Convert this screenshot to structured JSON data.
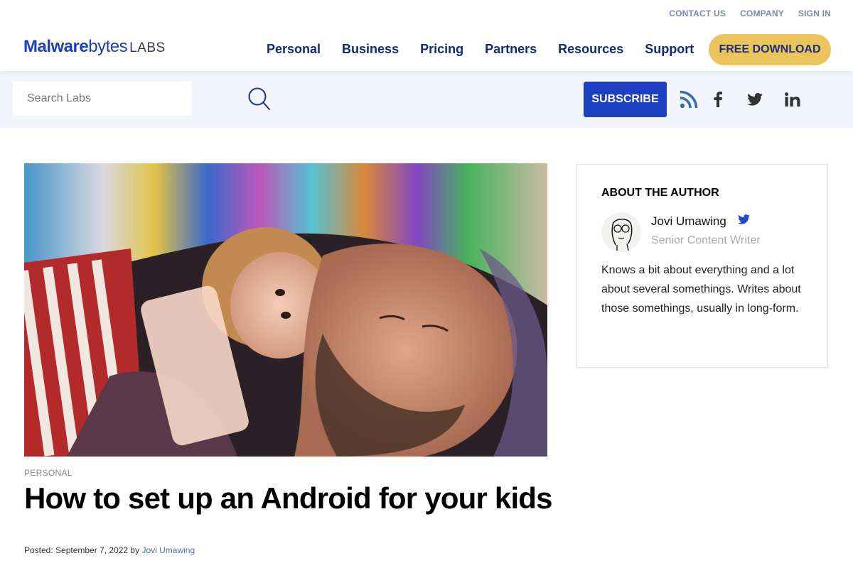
{
  "header": {
    "util_links": [
      "CONTACT US",
      "COMPANY",
      "SIGN IN"
    ],
    "logo": {
      "bold": "Malware",
      "light": "bytes",
      "suffix": "LABS"
    },
    "nav": [
      "Personal",
      "Business",
      "Pricing",
      "Partners",
      "Resources",
      "Support"
    ],
    "cta": "FREE DOWNLOAD"
  },
  "subbar": {
    "search_placeholder": "Search Labs",
    "subscribe": "SUBSCRIBE",
    "social_icons": [
      "rss-icon",
      "facebook-icon",
      "twitter-icon",
      "linkedin-icon"
    ]
  },
  "article": {
    "category": "PERSONAL",
    "title": "How to set up an Android for your kids",
    "posted_prefix": "Posted: September 7, 2022 by ",
    "author_link": "Jovi Umawing",
    "hero_alt": "Father and child looking at a phone under a colorful knitted blanket"
  },
  "author_card": {
    "heading": "ABOUT THE AUTHOR",
    "name": "Jovi Umawing",
    "role": "Senior Content Writer",
    "bio": "Knows a bit about everything and a lot about several somethings. Writes about those somethings, usually in long-form."
  },
  "colors": {
    "brand_blue": "#1d3fc1",
    "nav_navy": "#132b73",
    "cta_yellow": "#ecc45c",
    "subbar_bg": "#f2f6fc"
  }
}
